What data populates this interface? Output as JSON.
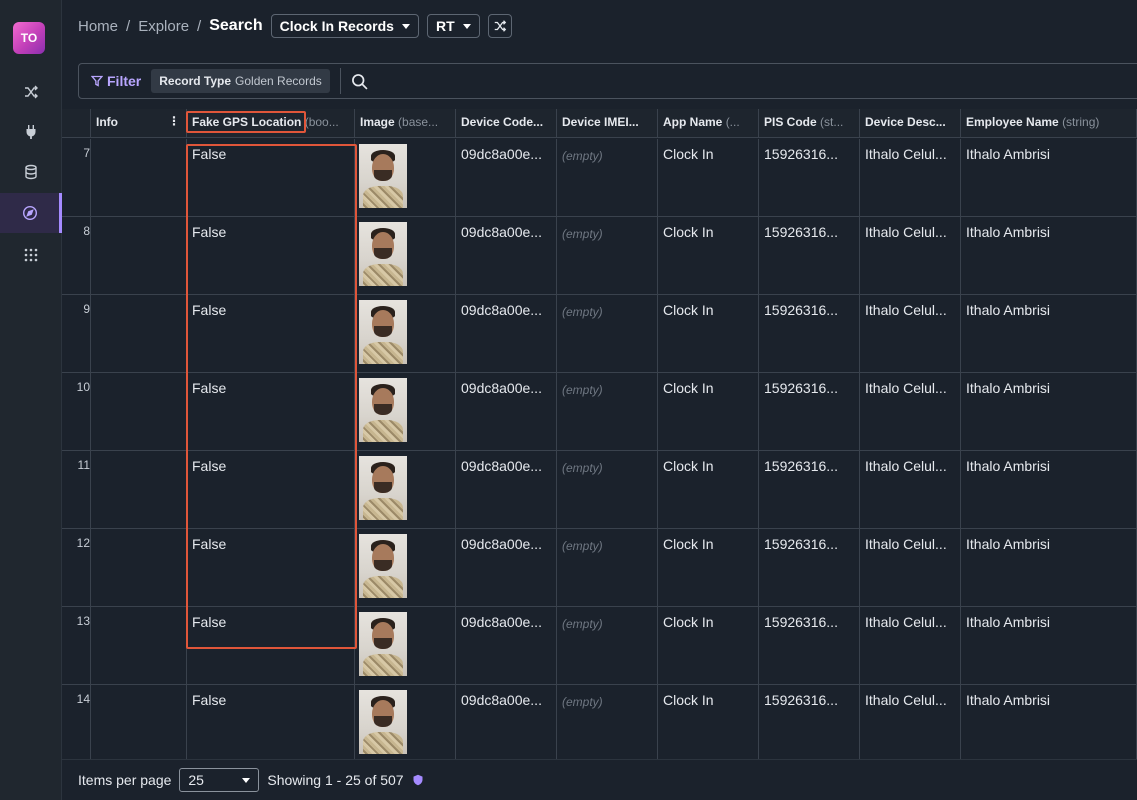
{
  "app": {
    "logo_text": "TO",
    "accent": "#a58bff",
    "highlight": "#e0563a"
  },
  "nav": {
    "items": [
      {
        "icon": "shuffle-icon"
      },
      {
        "icon": "plug-icon"
      },
      {
        "icon": "database-icon"
      },
      {
        "icon": "compass-icon",
        "active": true
      },
      {
        "icon": "grid-icon"
      }
    ]
  },
  "header": {
    "breadcrumb": [
      "Home",
      "Explore"
    ],
    "separator": "/",
    "current": "Search",
    "entity_dropdown": "Clock In Records",
    "rt_dropdown": "RT"
  },
  "filterbar": {
    "filter_label": "Filter",
    "chip_key": "Record Type",
    "chip_value": "Golden Records"
  },
  "table": {
    "columns": [
      {
        "name": "Info",
        "type": ""
      },
      {
        "name": "Fake GPS Location",
        "type": "(boo..."
      },
      {
        "name": "Image",
        "type": "(base..."
      },
      {
        "name": "Device Code...",
        "type": ""
      },
      {
        "name": "Device IMEI...",
        "type": ""
      },
      {
        "name": "App Name",
        "type": "(..."
      },
      {
        "name": "PIS Code",
        "type": "(st..."
      },
      {
        "name": "Device Desc...",
        "type": ""
      },
      {
        "name": "Employee Name",
        "type": "(string)"
      }
    ],
    "rows": [
      {
        "num": "7",
        "fake_gps": "False",
        "device_code": "09dc8a00e...",
        "imei": "(empty)",
        "app": "Clock In",
        "pis": "15926316...",
        "desc": "Ithalo Celul...",
        "employee": "Ithalo Ambrisi"
      },
      {
        "num": "8",
        "fake_gps": "False",
        "device_code": "09dc8a00e...",
        "imei": "(empty)",
        "app": "Clock In",
        "pis": "15926316...",
        "desc": "Ithalo Celul...",
        "employee": "Ithalo Ambrisi"
      },
      {
        "num": "9",
        "fake_gps": "False",
        "device_code": "09dc8a00e...",
        "imei": "(empty)",
        "app": "Clock In",
        "pis": "15926316...",
        "desc": "Ithalo Celul...",
        "employee": "Ithalo Ambrisi"
      },
      {
        "num": "10",
        "fake_gps": "False",
        "device_code": "09dc8a00e...",
        "imei": "(empty)",
        "app": "Clock In",
        "pis": "15926316...",
        "desc": "Ithalo Celul...",
        "employee": "Ithalo Ambrisi"
      },
      {
        "num": "11",
        "fake_gps": "False",
        "device_code": "09dc8a00e...",
        "imei": "(empty)",
        "app": "Clock In",
        "pis": "15926316...",
        "desc": "Ithalo Celul...",
        "employee": "Ithalo Ambrisi"
      },
      {
        "num": "12",
        "fake_gps": "False",
        "device_code": "09dc8a00e...",
        "imei": "(empty)",
        "app": "Clock In",
        "pis": "15926316...",
        "desc": "Ithalo Celul...",
        "employee": "Ithalo Ambrisi"
      },
      {
        "num": "13",
        "fake_gps": "False",
        "device_code": "09dc8a00e...",
        "imei": "(empty)",
        "app": "Clock In",
        "pis": "15926316...",
        "desc": "Ithalo Celul...",
        "employee": "Ithalo Ambrisi"
      },
      {
        "num": "14",
        "fake_gps": "False",
        "device_code": "09dc8a00e...",
        "imei": "(empty)",
        "app": "Clock In",
        "pis": "15926316...",
        "desc": "Ithalo Celul...",
        "employee": "Ithalo Ambrisi"
      }
    ]
  },
  "footer": {
    "items_per_page_label": "Items per page",
    "items_per_page": "25",
    "showing": "Showing 1 - 25 of 507"
  }
}
